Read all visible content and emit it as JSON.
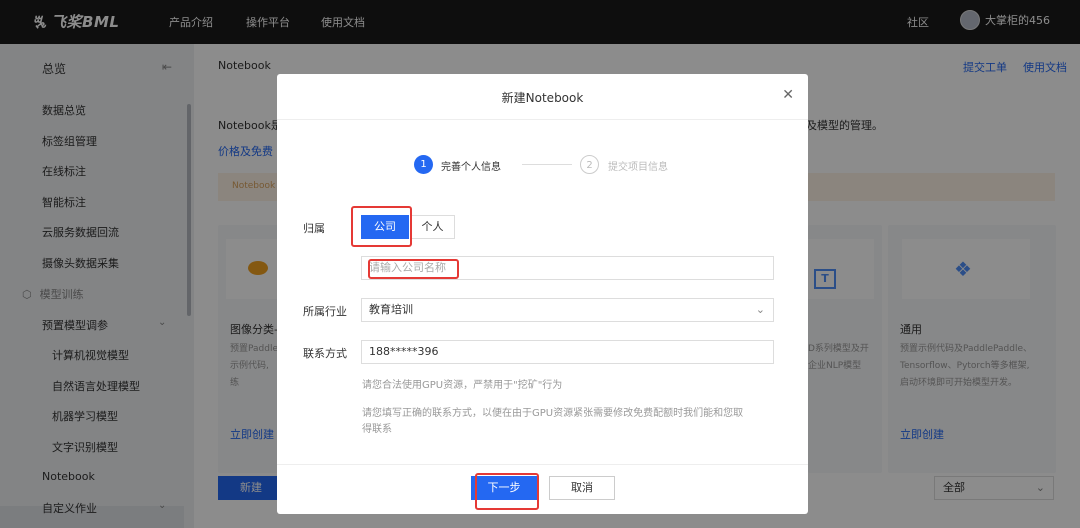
{
  "topbar": {
    "logo_mark": "ꔩ",
    "logo_text": "飞桨BML",
    "nav": [
      "产品介绍",
      "操作平台",
      "使用文档"
    ],
    "community": "社区",
    "username": "大掌柜的456"
  },
  "sidebar": {
    "overview": "总览",
    "items": [
      "数据总览",
      "标签组管理",
      "在线标注",
      "智能标注",
      "云服务数据回流",
      "摄像头数据采集"
    ],
    "section": "模型训练",
    "group": "预置模型调参",
    "sub_items": [
      "计算机视觉模型",
      "自然语言处理模型",
      "机器学习模型",
      "文字识别模型"
    ],
    "active": "Notebook",
    "custom": "自定义作业"
  },
  "main": {
    "breadcrumb": "Notebook",
    "ticket_link": "提交工单",
    "docs_link": "使用文档",
    "intro_start": "Notebook是",
    "intro_end": "及模型的管理。",
    "price_link": "价格及免费",
    "warn_text": "Notebook",
    "cards": [
      {
        "title": "图像分类-",
        "desc": "预置Paddle\n示例代码,\n练",
        "link": "立即创建"
      },
      {
        "title": "通用",
        "desc": "预置示例代码及PaddlePaddle、\nTensorflow、Pytorch等多框架,\n启动环境即可开始模型开发。",
        "link": "立即创建"
      }
    ],
    "nlp_card_desc": "D系列模型及开\n企业NLP模型",
    "new_button": "新建",
    "filter_value": "全部"
  },
  "modal": {
    "title": "新建Notebook",
    "steps": [
      {
        "num": "1",
        "label": "完善个人信息"
      },
      {
        "num": "2",
        "label": "提交项目信息"
      }
    ],
    "owner_label": "归属",
    "owner_options": [
      "公司",
      "个人"
    ],
    "owner_selected": "公司",
    "company_placeholder": "请输入公司名称",
    "industry_label": "所属行业",
    "industry_value": "教育培训",
    "contact_label": "联系方式",
    "contact_value": "188*****396",
    "hint1": "请您合法使用GPU资源，严禁用于\"挖矿\"行为",
    "hint2": "请您填写正确的联系方式，以便在由于GPU资源紧张需要修改免费配额时我们能和您取\n得联系",
    "next_button": "下一步",
    "cancel_button": "取消"
  },
  "colors": {
    "accent": "#2468f2",
    "highlight": "#e53935",
    "topbar": "#1a1a1a"
  }
}
